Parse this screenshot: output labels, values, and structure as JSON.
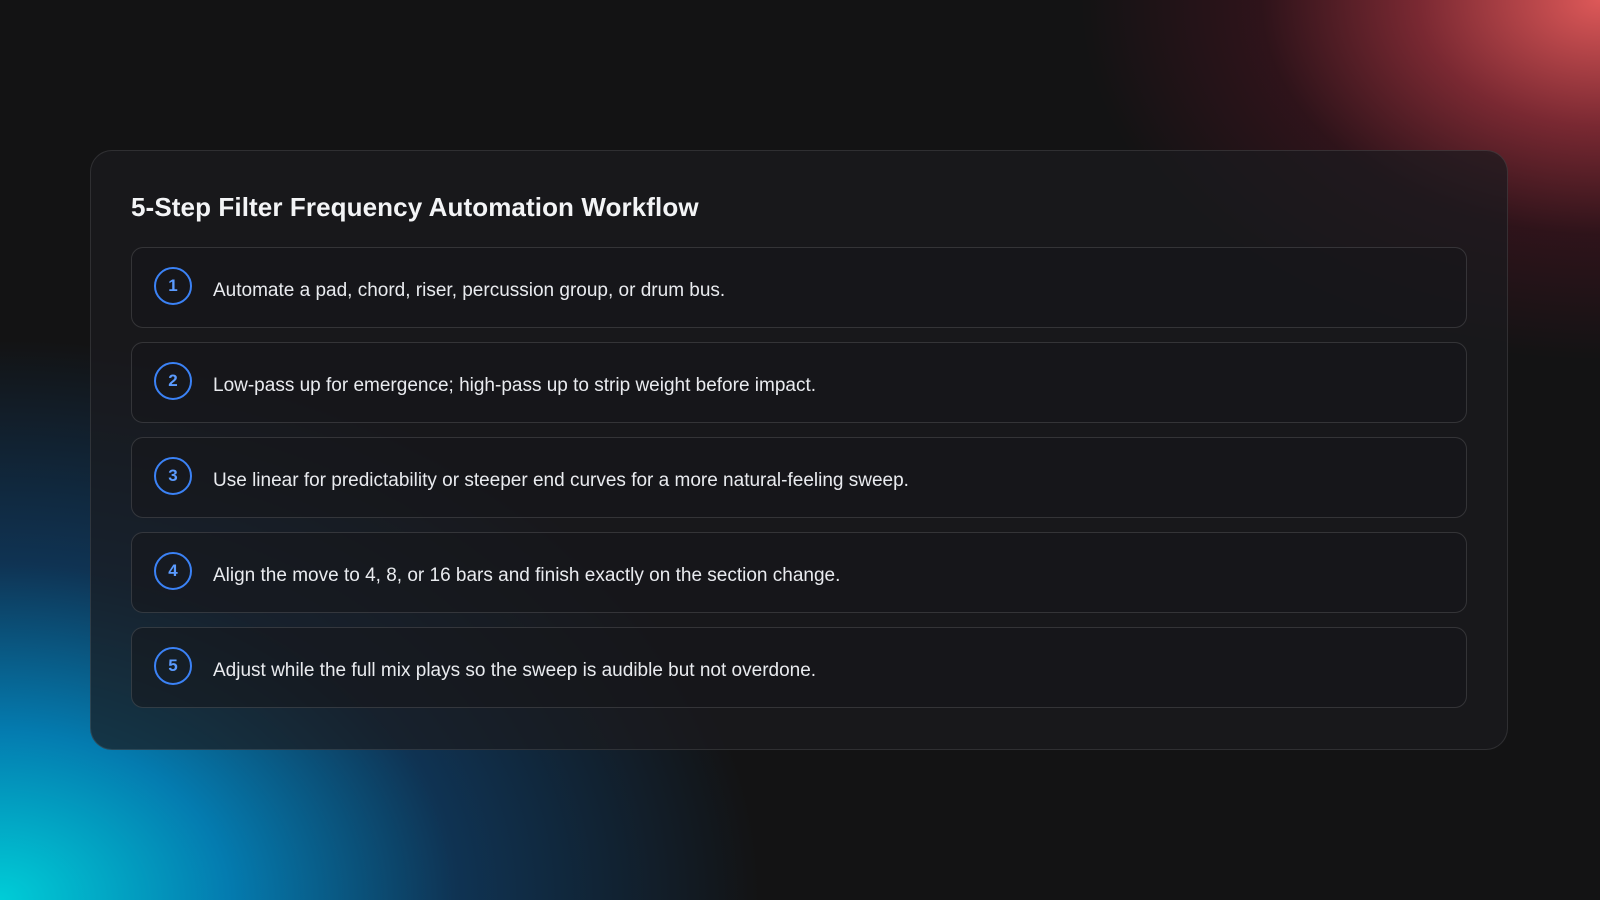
{
  "card": {
    "title": "5-Step Filter Frequency Automation Workflow"
  },
  "steps": [
    {
      "number": "1",
      "text": "Automate a pad, chord, riser, percussion group, or drum bus."
    },
    {
      "number": "2",
      "text": "Low-pass up for emergence; high-pass up to strip weight before impact."
    },
    {
      "number": "3",
      "text": "Use linear for predictability or steeper end curves for a more natural-feeling sweep."
    },
    {
      "number": "4",
      "text": "Align the move to 4, 8, or 16 bars and finish exactly on the section change."
    },
    {
      "number": "5",
      "text": "Adjust while the full mix plays so the sweep is audible but not overdone."
    }
  ],
  "colors": {
    "background": "#131314",
    "accent": "#3b82f6",
    "glow_top_right": "#e85c5c",
    "glow_bottom_left": "#00cdd7"
  }
}
